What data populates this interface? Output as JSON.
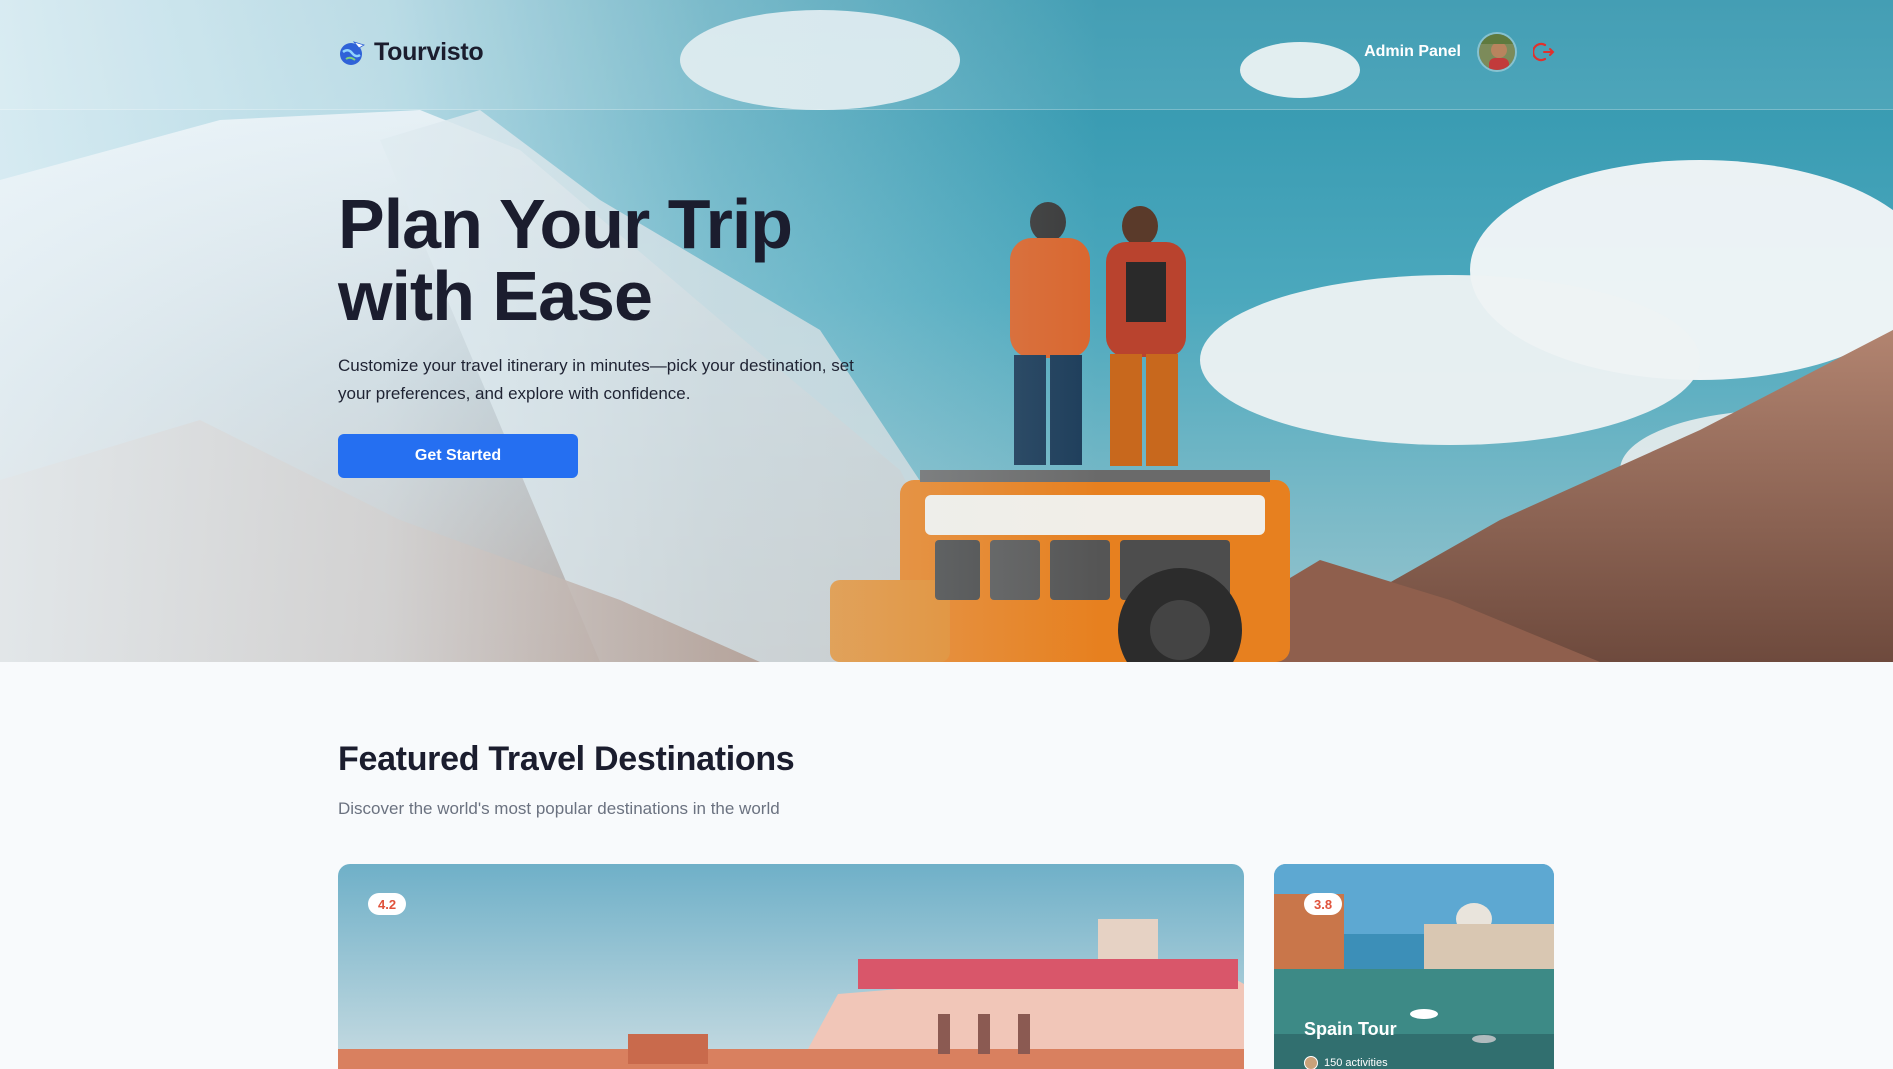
{
  "header": {
    "brand": "Tourvisto",
    "admin_link": "Admin Panel"
  },
  "icons": {
    "logo": "globe-plane-icon",
    "avatar": "user-avatar",
    "logout": "logout-icon"
  },
  "hero": {
    "title_line1": "Plan Your Trip",
    "title_line2": "with Ease",
    "description": "Customize your travel itinerary in minutes—pick your destination, set your preferences, and explore with confidence.",
    "cta_label": "Get Started"
  },
  "featured": {
    "title": "Featured Travel Destinations",
    "subtitle": "Discover the world's most popular destinations in the world",
    "cards": [
      {
        "rating": "4.2"
      },
      {
        "rating": "3.8",
        "name": "Spain Tour",
        "activities": "150 activities"
      }
    ]
  },
  "colors": {
    "primary": "#256ff1",
    "heading": "#1b1d2e",
    "rating_text": "#e0523b",
    "logout": "#e0312d"
  }
}
